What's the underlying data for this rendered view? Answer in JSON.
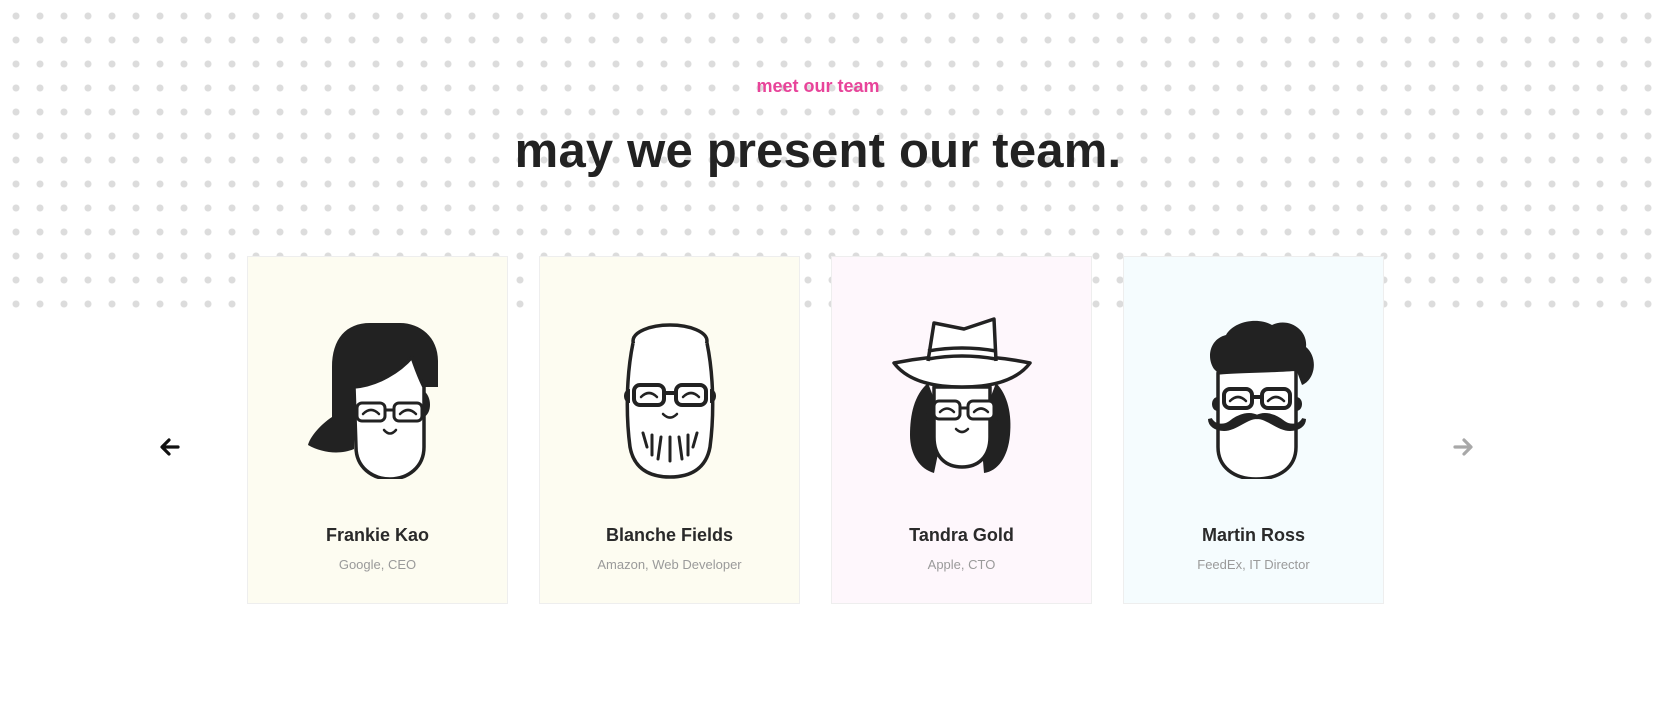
{
  "section": {
    "eyebrow": "meet our team",
    "headline": "may we present our team."
  },
  "colors": {
    "accent": "#e8449a",
    "card_yellow": "#fdfcf1",
    "card_pink": "#fef7fc",
    "card_blue": "#f5fcfe",
    "ink": "#222222"
  },
  "nav": {
    "prev_icon": "arrow-left-icon",
    "next_icon": "arrow-right-icon"
  },
  "members": [
    {
      "name": "Frankie Kao",
      "role": "Google, CEO",
      "avatar": "woman-glasses-avatar"
    },
    {
      "name": "Blanche Fields",
      "role": "Amazon, Web Developer",
      "avatar": "bearded-man-glasses-avatar"
    },
    {
      "name": "Tandra Gold",
      "role": "Apple, CTO",
      "avatar": "woman-hat-avatar"
    },
    {
      "name": "Martin Ross",
      "role": "FeedEx, IT Director",
      "avatar": "mustache-man-avatar"
    }
  ]
}
